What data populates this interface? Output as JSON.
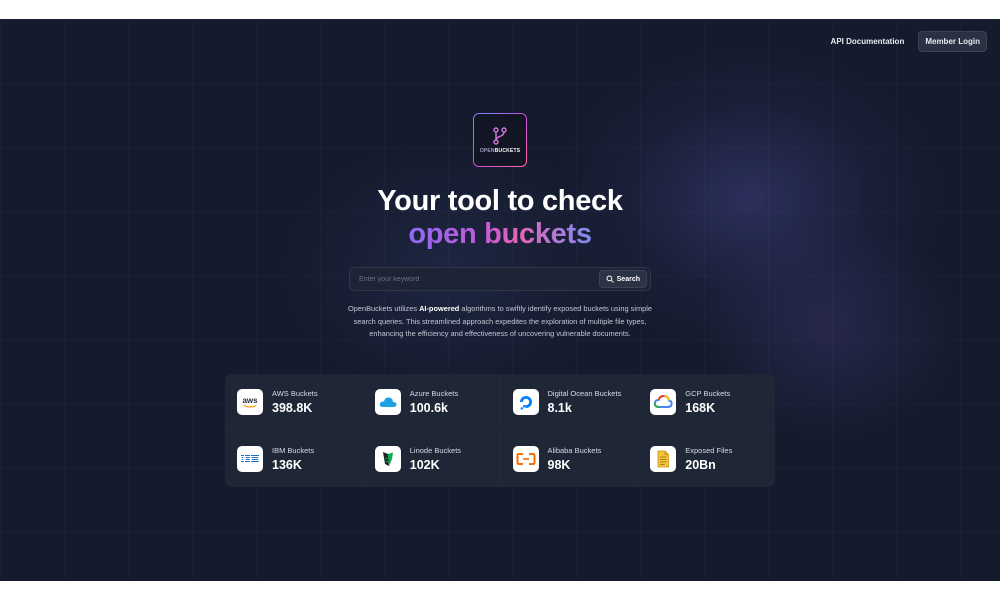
{
  "nav": {
    "api_docs": "API Documentation",
    "member_login": "Member Login"
  },
  "logo": {
    "text_open": "OPEN",
    "text_buckets": "BUCKETS"
  },
  "hero": {
    "line1": "Your tool to check",
    "line2": "open buckets"
  },
  "search": {
    "placeholder": "Enter your keyword",
    "button_label": "Search"
  },
  "description": {
    "part1": "OpenBuckets utilizes ",
    "bold": "AI-powered",
    "part2": " algorithms to swiftly identify exposed buckets using simple search queries. This streamlined approach expedites the exploration of multiple file types, enhancing the efficiency and effectiveness of uncovering vulnerable documents."
  },
  "stats": [
    {
      "label": "AWS Buckets",
      "value": "398.8K",
      "icon": "aws-icon"
    },
    {
      "label": "Azure Buckets",
      "value": "100.6k",
      "icon": "azure-icon"
    },
    {
      "label": "Digital Ocean Buckets",
      "value": "8.1k",
      "icon": "digital-ocean-icon"
    },
    {
      "label": "GCP Buckets",
      "value": "168K",
      "icon": "gcp-icon"
    },
    {
      "label": "IBM Buckets",
      "value": "136K",
      "icon": "ibm-icon"
    },
    {
      "label": "Linode Buckets",
      "value": "102K",
      "icon": "linode-icon"
    },
    {
      "label": "Alibaba Buckets",
      "value": "98K",
      "icon": "alibaba-icon"
    },
    {
      "label": "Exposed Files",
      "value": "20Bn",
      "icon": "file-icon"
    }
  ],
  "colors": {
    "background": "#151b2d",
    "accent_purple": "#8b6cf2",
    "accent_pink": "#e564b8"
  }
}
